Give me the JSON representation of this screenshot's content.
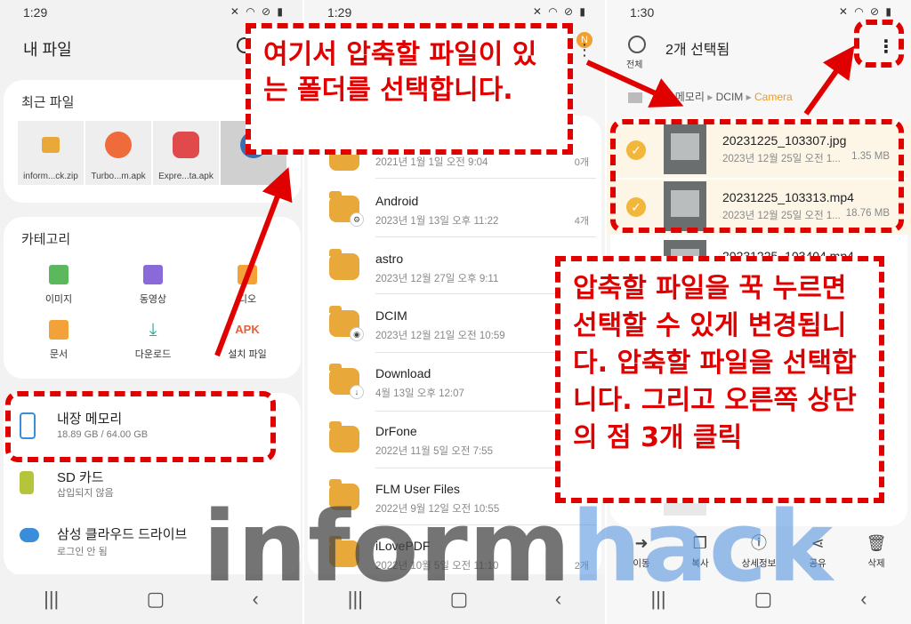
{
  "panel1": {
    "time": "1:29",
    "title": "내 파일",
    "recent": {
      "title": "최근 파일",
      "files": [
        "inform...ck.zip",
        "Turbo...m.apk",
        "Expre...ta.apk"
      ]
    },
    "categories": {
      "title": "카테고리",
      "items": [
        "이미지",
        "동영상",
        "디오",
        "문서",
        "다운로드",
        "설치 파일"
      ],
      "apk_icon": "APK"
    },
    "storage": [
      {
        "name": "내장 메모리",
        "sub": "18.89 GB / 64.00 GB"
      },
      {
        "name": "SD 카드",
        "sub": "삽입되지 않음"
      },
      {
        "name": "삼성 클라우드 드라이브",
        "sub": "로그인 안 됨"
      }
    ]
  },
  "panel2": {
    "time": "1:29",
    "avatar": "N",
    "folders": [
      {
        "name": "",
        "date": "2021년 1월 1일 오전 9:04",
        "count": "0개"
      },
      {
        "name": "Android",
        "date": "2023년 1월 13일 오후 11:22",
        "count": "4개",
        "badge": "⚙"
      },
      {
        "name": "astro",
        "date": "2023년 12월 27일 오후 9:11",
        "count": ""
      },
      {
        "name": "DCIM",
        "date": "2023년 12월 21일 오전 10:59",
        "count": "",
        "badge": "◉"
      },
      {
        "name": "Download",
        "date": "4월 13일 오후 12:07",
        "count": "",
        "badge": "↓"
      },
      {
        "name": "DrFone",
        "date": "2022년 11월 5일 오전 7:55",
        "count": ""
      },
      {
        "name": "FLM User Files",
        "date": "2022년 9월 12일 오전 10:55",
        "count": ""
      },
      {
        "name": "iLovePDF",
        "date": "2022년 10월 5일 오전 11:10",
        "count": "2개"
      }
    ]
  },
  "panel3": {
    "time": "1:30",
    "select_all": "전체",
    "selected_title": "2개 선택됨",
    "breadcrumb": [
      "내장 메모리",
      "DCIM",
      "Camera"
    ],
    "files": [
      {
        "name": "20231225_103307.jpg",
        "date": "2023년 12월 25일 오전 1...",
        "size": "1.35 MB",
        "checked": true
      },
      {
        "name": "20231225_103313.mp4",
        "date": "2023년 12월 25일 오전 1...",
        "size": "18.76 MB",
        "checked": true
      },
      {
        "name": "20231225_103404.mp4",
        "date": "",
        "size": "",
        "checked": false
      }
    ],
    "actions": [
      "이동",
      "복사",
      "상세정보",
      "공유",
      "삭제"
    ]
  },
  "callouts": {
    "top": "여기서 압축할 파일이 있는 폴더를 선택합니다.",
    "right": "압축할 파일을 꾹 누르면 선택할 수 있게 변경됩니다. 압축할 파일을 선택합니다. 그리고 오른쪽 상단의 점 3개 클릭"
  },
  "watermark": {
    "part1": "inform",
    "part2": "hack"
  },
  "colors": {
    "highlight": "#e00000",
    "folder": "#e9a83a",
    "check": "#f2b73a",
    "avatar": "#f0a030"
  },
  "icons": {
    "search": "search-icon",
    "more": "more-vertical-icon",
    "storage": "phone-storage-icon",
    "sd": "sd-card-icon",
    "cloud": "cloud-icon"
  }
}
